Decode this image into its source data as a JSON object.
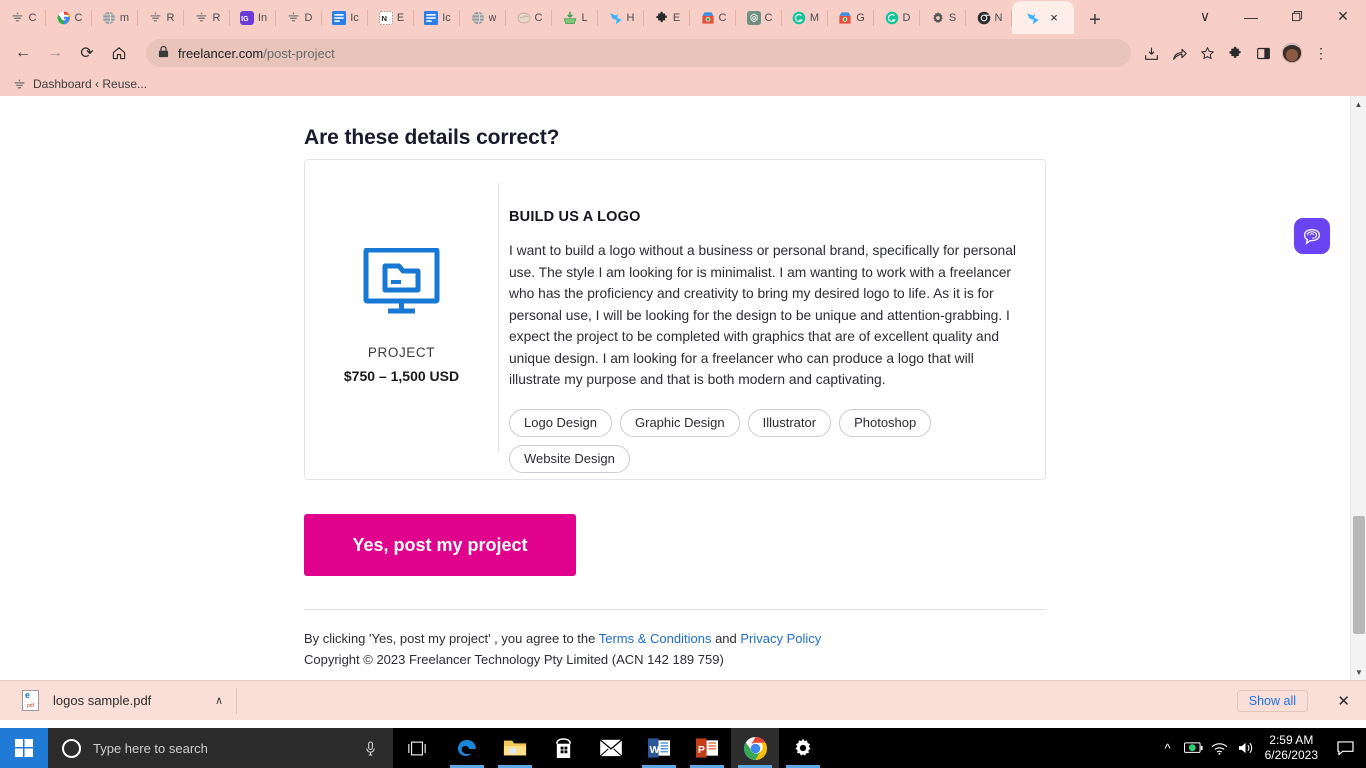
{
  "browser": {
    "tabs": [
      {
        "icon": "freelancer-icon",
        "label": "C"
      },
      {
        "icon": "google-icon",
        "label": "C"
      },
      {
        "icon": "globe-icon",
        "label": "m"
      },
      {
        "icon": "freelancer-icon",
        "label": "R"
      },
      {
        "icon": "freelancer-icon",
        "label": "R"
      },
      {
        "icon": "instagram-icon",
        "label": "In"
      },
      {
        "icon": "freelancer-icon",
        "label": "D"
      },
      {
        "icon": "docs-icon",
        "label": "Ic"
      },
      {
        "icon": "notion-icon",
        "label": "E"
      },
      {
        "icon": "docs-icon",
        "label": "Ic"
      },
      {
        "icon": "globe-icon",
        "label": "w"
      },
      {
        "icon": "brain-icon",
        "label": "C"
      },
      {
        "icon": "download-icon",
        "label": "L"
      },
      {
        "icon": "grammarly-icon",
        "label": "H"
      },
      {
        "icon": "puzzle-icon",
        "label": "E"
      },
      {
        "icon": "chrome-store-icon",
        "label": "C"
      },
      {
        "icon": "openai-icon",
        "label": "C"
      },
      {
        "icon": "grammarly-green-icon",
        "label": "M"
      },
      {
        "icon": "chrome-store-icon",
        "label": "G"
      },
      {
        "icon": "grammarly-green-icon",
        "label": "D"
      },
      {
        "icon": "gear-icon",
        "label": "S"
      },
      {
        "icon": "chrome-dark-icon",
        "label": "N"
      }
    ],
    "active_tab": {
      "icon": "grammarly-icon",
      "label": "",
      "close": "×"
    },
    "new_tab_label": "+",
    "window_controls": {
      "minimize_list": "∨",
      "minimize": "—",
      "maximize": "❐",
      "close": "✕"
    },
    "nav": {
      "back": "←",
      "forward": "→",
      "reload": "⟳",
      "home": "⌂"
    },
    "url_domain": "freelancer.com",
    "url_path": "/post-project",
    "lock_icon": "lock-icon",
    "toolbar_icons": [
      "install-icon",
      "share-icon",
      "bookmark-star-icon",
      "extensions-puzzle-icon",
      "sidepanel-icon"
    ],
    "menu_icon": "⋮",
    "bookmark": {
      "icon": "freelancer-icon",
      "label": "Dashboard ‹ Reuse..."
    }
  },
  "page": {
    "heading": "Are these details correct?",
    "project": {
      "icon": "monitor-folder-icon",
      "type_label": "PROJECT",
      "budget": "$750 – 1,500 USD",
      "title": "BUILD US A LOGO",
      "description": "I want to build a logo without a business or personal brand, specifically for personal use. The style I am looking for is minimalist. I am wanting to work with a freelancer who has the proficiency and creativity to bring my desired logo to life. As it is for personal use, I will be looking for the design to be unique and attention-grabbing. I expect the project to be completed with graphics that are of excellent quality and unique design. I am looking for a freelancer who can produce a logo that will illustrate my purpose and that is both modern and captivating.",
      "tags": [
        "Logo Design",
        "Graphic Design",
        "Illustrator",
        "Photoshop",
        "Website Design"
      ]
    },
    "cta_label": "Yes, post my project",
    "legal": {
      "prefix": "By clicking 'Yes, post my project' , you agree to the ",
      "terms_link": "Terms & Conditions",
      "conjunction": " and ",
      "privacy_link": "Privacy Policy",
      "copyright": "Copyright © 2023 Freelancer Technology Pty Limited (ACN 142 189 759)"
    },
    "chat_widget_icon": "chat-bubble-icon",
    "accent_color": "#e0018c",
    "icon_color": "#1779d3"
  },
  "downloads": {
    "file_name": "logos sample.pdf",
    "file_icon": "pdf-file-icon",
    "caret": "∧",
    "show_all_label": "Show all",
    "close": "✕"
  },
  "taskbar": {
    "start_icon": "windows-start-icon",
    "search_placeholder": "Type here to search",
    "cortana_icon": "cortana-icon",
    "mic_icon": "microphone-icon",
    "task_view_icon": "task-view-icon",
    "apps": [
      "edge-icon",
      "file-explorer-icon",
      "microsoft-store-icon",
      "mail-icon",
      "word-icon",
      "powerpoint-icon",
      "chrome-icon",
      "settings-icon"
    ],
    "tray_icons": [
      "show-hidden-icons-icon",
      "battery-icon",
      "wifi-icon",
      "volume-icon"
    ],
    "time": "2:59 AM",
    "date": "6/26/2023",
    "action_center_icon": "action-center-icon"
  }
}
